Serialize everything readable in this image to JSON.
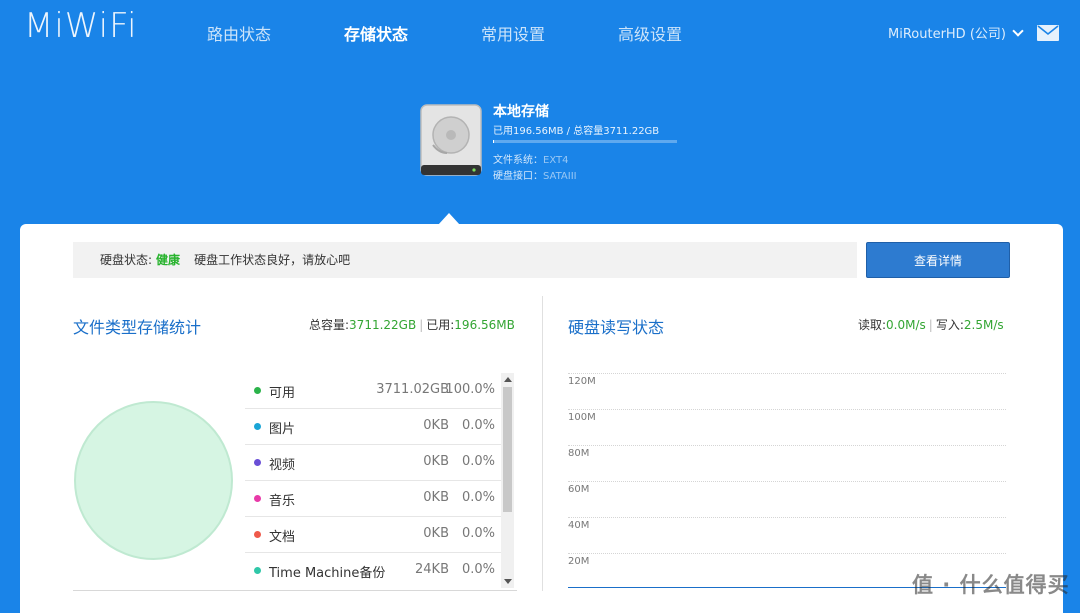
{
  "header": {
    "logo": "MiWiFi",
    "nav": [
      {
        "label": "路由状态"
      },
      {
        "label": "存储状态",
        "active": true
      },
      {
        "label": "常用设置"
      },
      {
        "label": "高级设置"
      }
    ],
    "router_name": "MiRouterHD (公司)"
  },
  "disk": {
    "title": "本地存储",
    "usage": "已用196.56MB / 总容量3711.22GB",
    "used_fraction": 5e-05,
    "fs_label": "文件系统：",
    "fs_value": "EXT4",
    "port_label": "硬盘接口：",
    "port_value": "SATAIII"
  },
  "status": {
    "label": "硬盘状态:",
    "value": "健康",
    "message": "硬盘工作状态良好，请放心吧",
    "detail_button": "查看详情"
  },
  "file_stats": {
    "title": "文件类型存储统计",
    "total_label": "总容量:",
    "total_value": "3711.22GB",
    "used_label": "已用:",
    "used_value": "196.56MB",
    "items": [
      {
        "name": "可用",
        "size": "3711.02GB",
        "pct": "100.0%",
        "color": "#2bb34a"
      },
      {
        "name": "图片",
        "size": "0KB",
        "pct": "0.0%",
        "color": "#1aa5d6"
      },
      {
        "name": "视频",
        "size": "0KB",
        "pct": "0.0%",
        "color": "#6a4fd6"
      },
      {
        "name": "音乐",
        "size": "0KB",
        "pct": "0.0%",
        "color": "#e83aa8"
      },
      {
        "name": "文档",
        "size": "0KB",
        "pct": "0.0%",
        "color": "#ef5a4b"
      },
      {
        "name": "Time Machine备份",
        "size": "24KB",
        "pct": "0.0%",
        "color": "#2fc7a8"
      }
    ]
  },
  "rw_status": {
    "title": "硬盘读写状态",
    "read_label": "读取:",
    "read_value": "0.0M/s",
    "write_label": "写入:",
    "write_value": "2.5M/s",
    "y_ticks": [
      "120M",
      "100M",
      "80M",
      "60M",
      "40M",
      "20M"
    ]
  },
  "watermark": "值 · 什么值得买",
  "colors": {
    "background": "#1a84e8",
    "accent": "#1a6fc9",
    "healthy": "#28b32e",
    "button": "#2d7bd0"
  }
}
